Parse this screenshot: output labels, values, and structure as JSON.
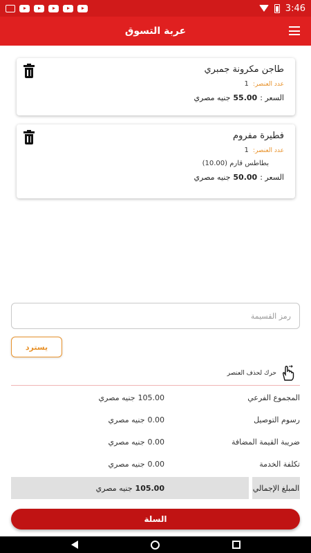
{
  "status_bar": {
    "time": "3:46"
  },
  "app_bar": {
    "title": "عربة التسوق"
  },
  "cart_items": [
    {
      "name": "طاجن مكرونة جمبري",
      "qty_label": "عدد العنصر:",
      "qty": "1",
      "extra": "",
      "price_label": "السعر :",
      "price": "55.00",
      "currency": "جنيه مصري"
    },
    {
      "name": "فطيرة مفروم",
      "qty_label": "عدد العنصر:",
      "qty": "1",
      "extra": "بطاطس قارم (10.00)",
      "price_label": "السعر :",
      "price": "50.00",
      "currency": "جنيه مصري"
    }
  ],
  "coupon": {
    "placeholder": "رمز القسيمة"
  },
  "redeem_label": "يسترد",
  "swipe_hint": "حرك لحذف العنصر",
  "summary": {
    "subtotal_label": "المجموع الفرعي",
    "subtotal": "105.00",
    "delivery_label": "رسوم التوصيل",
    "delivery": "0.00",
    "vat_label": "ضريبة القيمة المضافة",
    "vat": "0.00",
    "service_label": "تكلفة الخدمة",
    "service": "0.00",
    "total_label": "المبلغ الإجمالي",
    "total": "105.00",
    "currency": "جنيه مصري"
  },
  "cart_button_label": "السلة",
  "colors": {
    "primary": "#e02020",
    "accent": "#e8922b",
    "button": "#c01313"
  }
}
